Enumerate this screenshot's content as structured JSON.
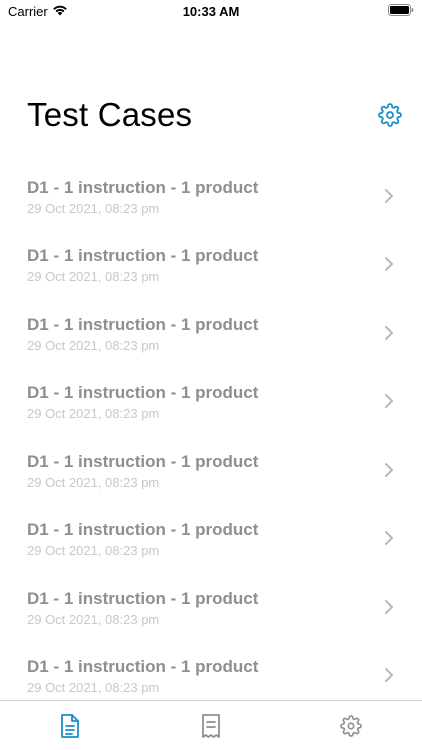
{
  "status_bar": {
    "carrier": "Carrier",
    "time": "10:33 AM"
  },
  "header": {
    "title": "Test Cases"
  },
  "list": {
    "items": [
      {
        "title": "D1 - 1 instruction - 1 product",
        "date": "29 Oct 2021, 08:23 pm"
      },
      {
        "title": "D1 - 1 instruction - 1 product",
        "date": "29 Oct 2021, 08:23 pm"
      },
      {
        "title": "D1 - 1 instruction - 1 product",
        "date": "29 Oct 2021, 08:23 pm"
      },
      {
        "title": "D1 - 1 instruction - 1 product",
        "date": "29 Oct 2021, 08:23 pm"
      },
      {
        "title": "D1 - 1 instruction - 1 product",
        "date": "29 Oct 2021, 08:23 pm"
      },
      {
        "title": "D1 - 1 instruction - 1 product",
        "date": "29 Oct 2021, 08:23 pm"
      },
      {
        "title": "D1 - 1 instruction - 1 product",
        "date": "29 Oct 2021, 08:23 pm"
      },
      {
        "title": "D1 - 1 instruction - 1 product",
        "date": "29 Oct 2021, 08:23 pm"
      }
    ]
  },
  "tab_bar": {
    "tabs": [
      {
        "icon": "document-icon",
        "active": true
      },
      {
        "icon": "receipt-icon",
        "active": false
      },
      {
        "icon": "gear-icon",
        "active": false
      }
    ]
  },
  "colors": {
    "accent": "#1a8fc9",
    "inactive_icon": "#8e8e93",
    "item_title": "#8e8e93",
    "item_subtitle": "#c7c7cc"
  }
}
